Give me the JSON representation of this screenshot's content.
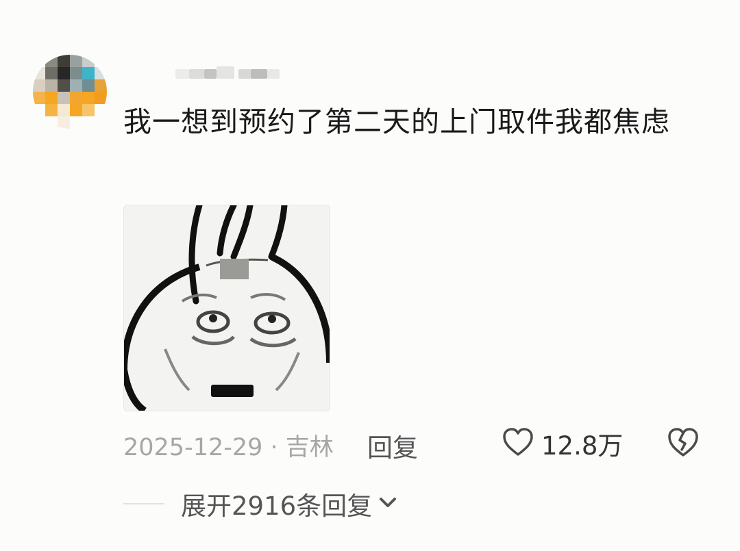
{
  "comment": {
    "text": "我一想到预约了第二天的上门取件我都焦虑",
    "date_location": "2025-12-29 · 吉林",
    "reply_label": "回复",
    "like_count": "12.8万",
    "expand_replies_label": "展开2916条回复"
  },
  "icons": {
    "like": "heart-outline-icon",
    "dislike": "broken-heart-icon",
    "expand": "chevron-down-icon"
  },
  "colors": {
    "background": "#fcfcfa",
    "text": "#1a1a1a",
    "meta": "#a6a6a6",
    "avatar_accent": "#f5a623"
  }
}
